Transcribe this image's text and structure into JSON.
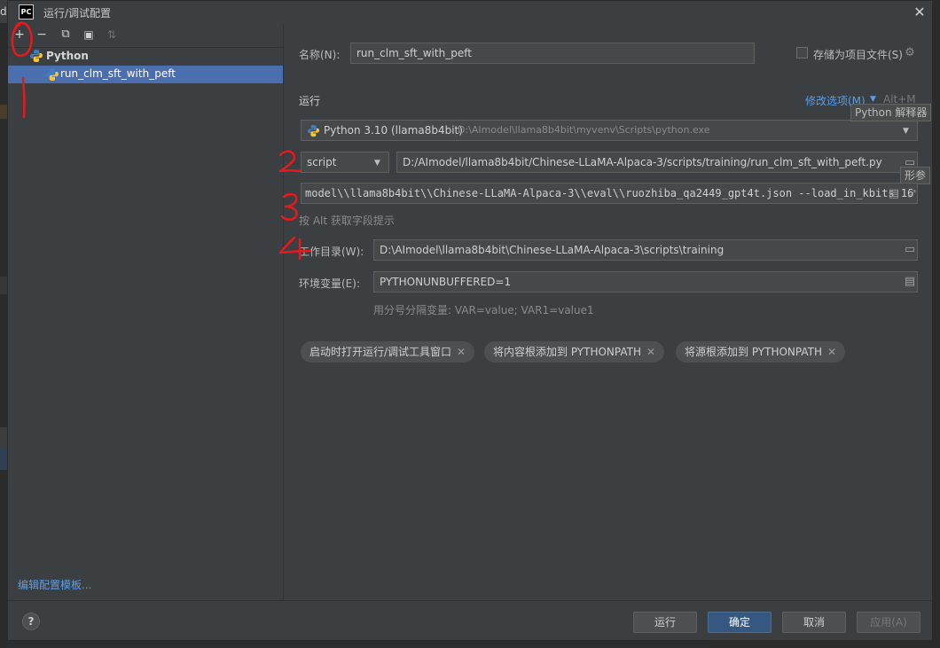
{
  "window": {
    "app_logo": "PC",
    "title": "运行/调试配置"
  },
  "background": {
    "left_letter": "d"
  },
  "toolbar": {
    "add": "+",
    "remove": "−",
    "copy": "⧉",
    "folder": "▣",
    "sort": "⇅"
  },
  "tree": {
    "group_label": "Python",
    "selected_item": "run_clm_sft_with_peft"
  },
  "left_footer": {
    "edit_templates": "编辑配置模板..."
  },
  "form": {
    "name_label": "名称(N):",
    "name_value": "run_clm_sft_with_peft",
    "store_project_label": "存储为项目文件(S)",
    "run_section": "运行",
    "modify_options": "修改选项(M)",
    "modify_shortcut": "Alt+M",
    "interpreter_name": "Python 3.10 (llama8b4bit)",
    "interpreter_path": "D:\\AImodel\\llama8b4bit\\myvenv\\Scripts\\python.exe",
    "interpreter_tooltip": "Python 解释器",
    "script_type": "script",
    "script_path": "D:/AImodel/llama8b4bit/Chinese-LLaMA-Alpaca-3/scripts/training/run_clm_sft_with_peft.py",
    "params_tooltip": "形参",
    "params_value": "model\\\\llama8b4bit\\\\Chinese-LLaMA-Alpaca-3\\\\eval\\\\ruozhiba_qa2449_gpt4t.json --load_in_kbits 16",
    "alt_hint": "按 Alt 获取字段提示",
    "workdir_label": "工作目录(W):",
    "workdir_value": "D:\\AImodel\\llama8b4bit\\Chinese-LLaMA-Alpaca-3\\scripts\\training",
    "env_label": "环境变量(E):",
    "env_value": "PYTHONUNBUFFERED=1",
    "env_hint": "用分号分隔变量: VAR=value; VAR1=value1"
  },
  "chips": [
    "启动时打开运行/调试工具窗口",
    "将内容根添加到 PYTHONPATH",
    "将源根添加到 PYTHONPATH"
  ],
  "buttons": {
    "help": "?",
    "run": "运行",
    "ok": "确定",
    "cancel": "取消",
    "apply": "应用(A)"
  },
  "colors": {
    "accent": "#4b6eaf",
    "link": "#5c9ee5",
    "annotation_red": "#e8191c"
  }
}
